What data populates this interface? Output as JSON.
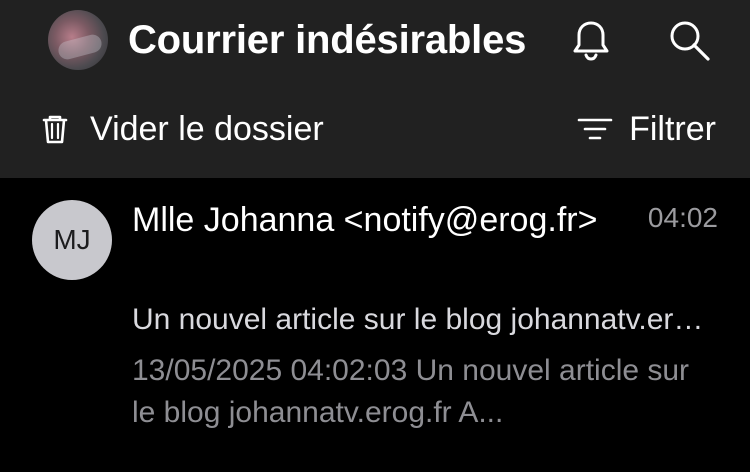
{
  "header": {
    "title": "Courrier indésirables",
    "bell_icon": "bell-icon",
    "search_icon": "search-icon"
  },
  "toolbar": {
    "empty_label": "Vider le dossier",
    "empty_icon": "trash-icon",
    "filter_label": "Filtrer",
    "filter_icon": "filter-icon"
  },
  "messages": [
    {
      "initials": "MJ",
      "sender": "Mlle Johanna <notify@erog.fr>",
      "time": "04:02",
      "subject": "Un nouvel article sur le blog johannatv.erog.fr",
      "preview": "13/05/2025 04:02:03 Un nouvel article sur le blog johannatv.erog.fr A..."
    }
  ],
  "colors": {
    "header_bg": "#212121",
    "list_bg": "#000000",
    "avatar_bg": "#c8c8cd",
    "secondary_text": "#8e8e93"
  }
}
